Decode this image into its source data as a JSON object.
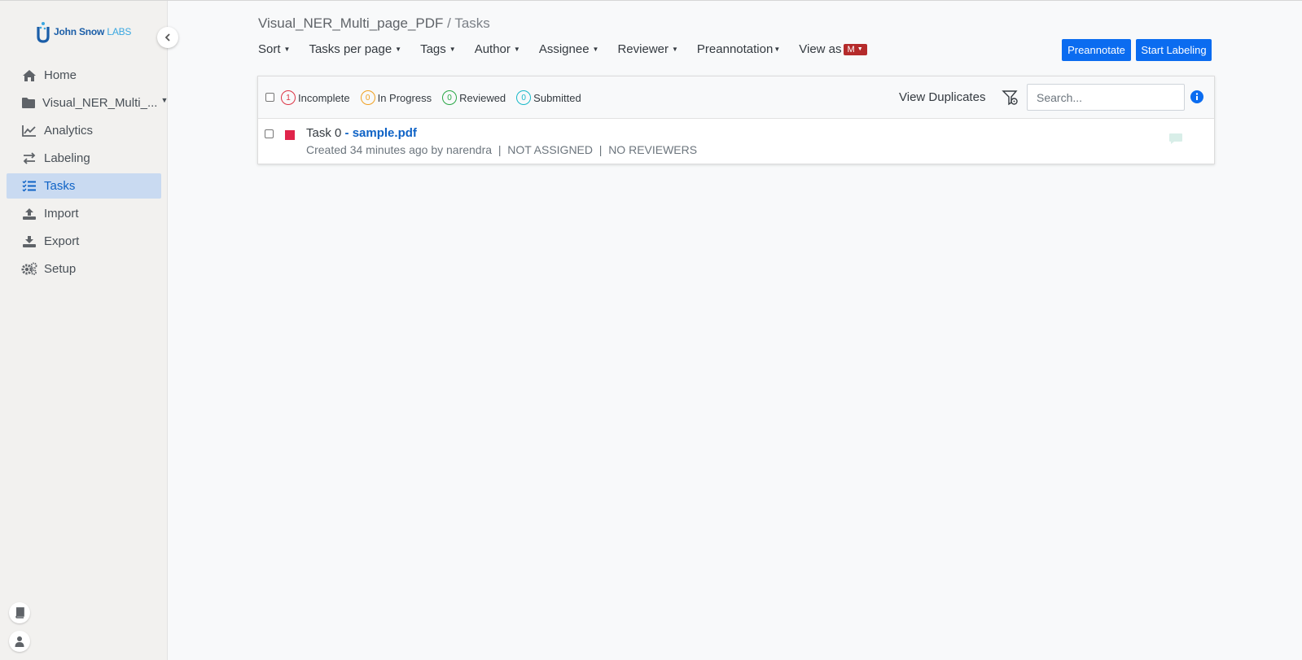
{
  "sidebar": {
    "logo": {
      "brand": "John Snow",
      "suffix": "LABS"
    },
    "items": [
      {
        "label": "Home",
        "icon": "home-icon"
      },
      {
        "label": "Visual_NER_Multi_...",
        "icon": "folder-icon"
      },
      {
        "label": "Analytics",
        "icon": "chart-line-icon"
      },
      {
        "label": "Labeling",
        "icon": "exchange-icon"
      },
      {
        "label": "Tasks",
        "icon": "tasks-list-icon"
      },
      {
        "label": "Import",
        "icon": "upload-icon"
      },
      {
        "label": "Export",
        "icon": "download-icon"
      },
      {
        "label": "Setup",
        "icon": "gears-icon"
      }
    ],
    "active_item": "Tasks"
  },
  "header": {
    "project": "Visual_NER_Multi_page_PDF",
    "separator": "/",
    "current": "Tasks"
  },
  "toolbar": {
    "sort": "Sort",
    "tasks_per_page": "Tasks per page",
    "tags": "Tags",
    "author": "Author",
    "assignee": "Assignee",
    "reviewer": "Reviewer",
    "preannotation": "Preannotation",
    "view_as": "View as",
    "view_as_badge": "M",
    "preannotate_btn": "Preannotate",
    "start_labeling_btn": "Start Labeling"
  },
  "filters": {
    "statuses": [
      {
        "count": "1",
        "label": "Incomplete",
        "color": "#dc3545"
      },
      {
        "count": "0",
        "label": "In Progress",
        "color": "#f0a020"
      },
      {
        "count": "0",
        "label": "Reviewed",
        "color": "#28a745"
      },
      {
        "count": "0",
        "label": "Submitted",
        "color": "#17b8c8"
      }
    ],
    "view_duplicates": "View Duplicates",
    "search_placeholder": "Search..."
  },
  "tasks": [
    {
      "id": "Task 0",
      "title_sep": " - ",
      "file": "sample.pdf",
      "meta": "Created 34 minutes ago by narendra  |  NOT ASSIGNED  |  NO REVIEWERS",
      "status_color": "#e0244a"
    }
  ],
  "colors": {
    "primary": "#0b6cf0",
    "active_nav_bg": "#c9daf1",
    "badge": "#b52b2b"
  }
}
